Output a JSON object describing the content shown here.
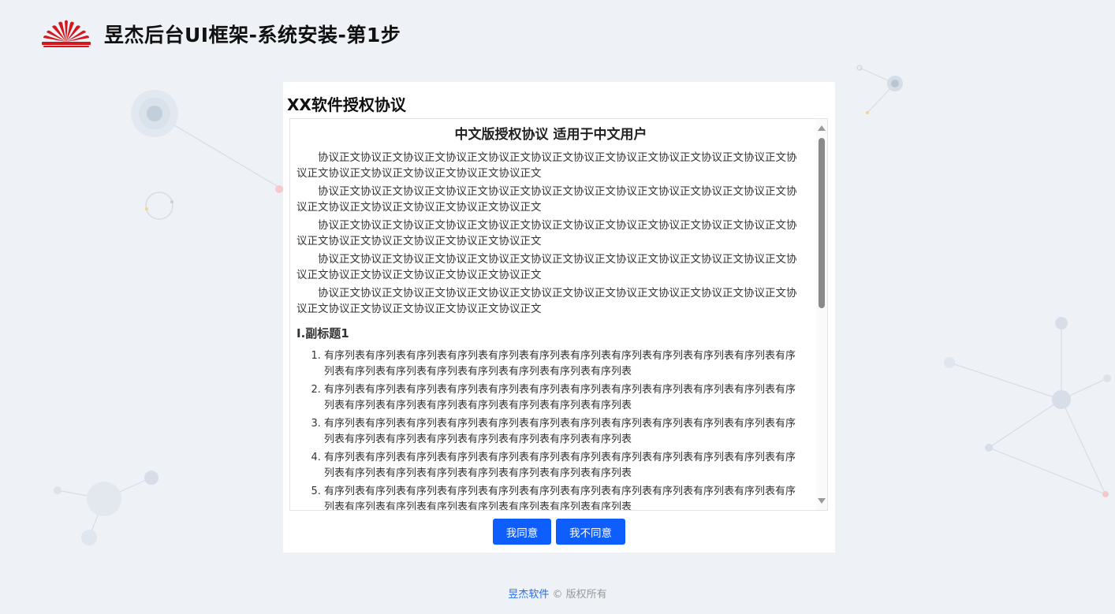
{
  "header": {
    "title": "昱杰后台UI框架-系统安装-第1步"
  },
  "panel": {
    "title": "XX软件授权协议"
  },
  "agreement": {
    "title": "中文版授权协议 适用于中文用户",
    "paragraphs": [
      "协议正文协议正文协议正文协议正文协议正文协议正文协议正文协议正文协议正文协议正文协议正文协议正文协议正文协议正文协议正文协议正文协议正文",
      "协议正文协议正文协议正文协议正文协议正文协议正文协议正文协议正文协议正文协议正文协议正文协议正文协议正文协议正文协议正文协议正文协议正文",
      "协议正文协议正文协议正文协议正文协议正文协议正文协议正文协议正文协议正文协议正文协议正文协议正文协议正文协议正文协议正文协议正文协议正文",
      "协议正文协议正文协议正文协议正文协议正文协议正文协议正文协议正文协议正文协议正文协议正文协议正文协议正文协议正文协议正文协议正文协议正文",
      "协议正文协议正文协议正文协议正文协议正文协议正文协议正文协议正文协议正文协议正文协议正文协议正文协议正文协议正文协议正文协议正文协议正文"
    ],
    "subtitle": "I.副标题1",
    "list_items": [
      "有序列表有序列表有序列表有序列表有序列表有序列表有序列表有序列表有序列表有序列表有序列表有序列表有序列表有序列表有序列表有序列表有序列表有序列表有序列表",
      "有序列表有序列表有序列表有序列表有序列表有序列表有序列表有序列表有序列表有序列表有序列表有序列表有序列表有序列表有序列表有序列表有序列表有序列表有序列表",
      "有序列表有序列表有序列表有序列表有序列表有序列表有序列表有序列表有序列表有序列表有序列表有序列表有序列表有序列表有序列表有序列表有序列表有序列表有序列表",
      "有序列表有序列表有序列表有序列表有序列表有序列表有序列表有序列表有序列表有序列表有序列表有序列表有序列表有序列表有序列表有序列表有序列表有序列表有序列表",
      "有序列表有序列表有序列表有序列表有序列表有序列表有序列表有序列表有序列表有序列表有序列表有序列表有序列表有序列表有序列表有序列表有序列表有序列表有序列表"
    ]
  },
  "buttons": {
    "agree": "我同意",
    "disagree": "我不同意"
  },
  "footer": {
    "brand": "昱杰软件",
    "copyright": "© 版权所有"
  },
  "colors": {
    "primary": "#0d5efc",
    "logo": "#d3171c",
    "background": "#eef1f6"
  }
}
